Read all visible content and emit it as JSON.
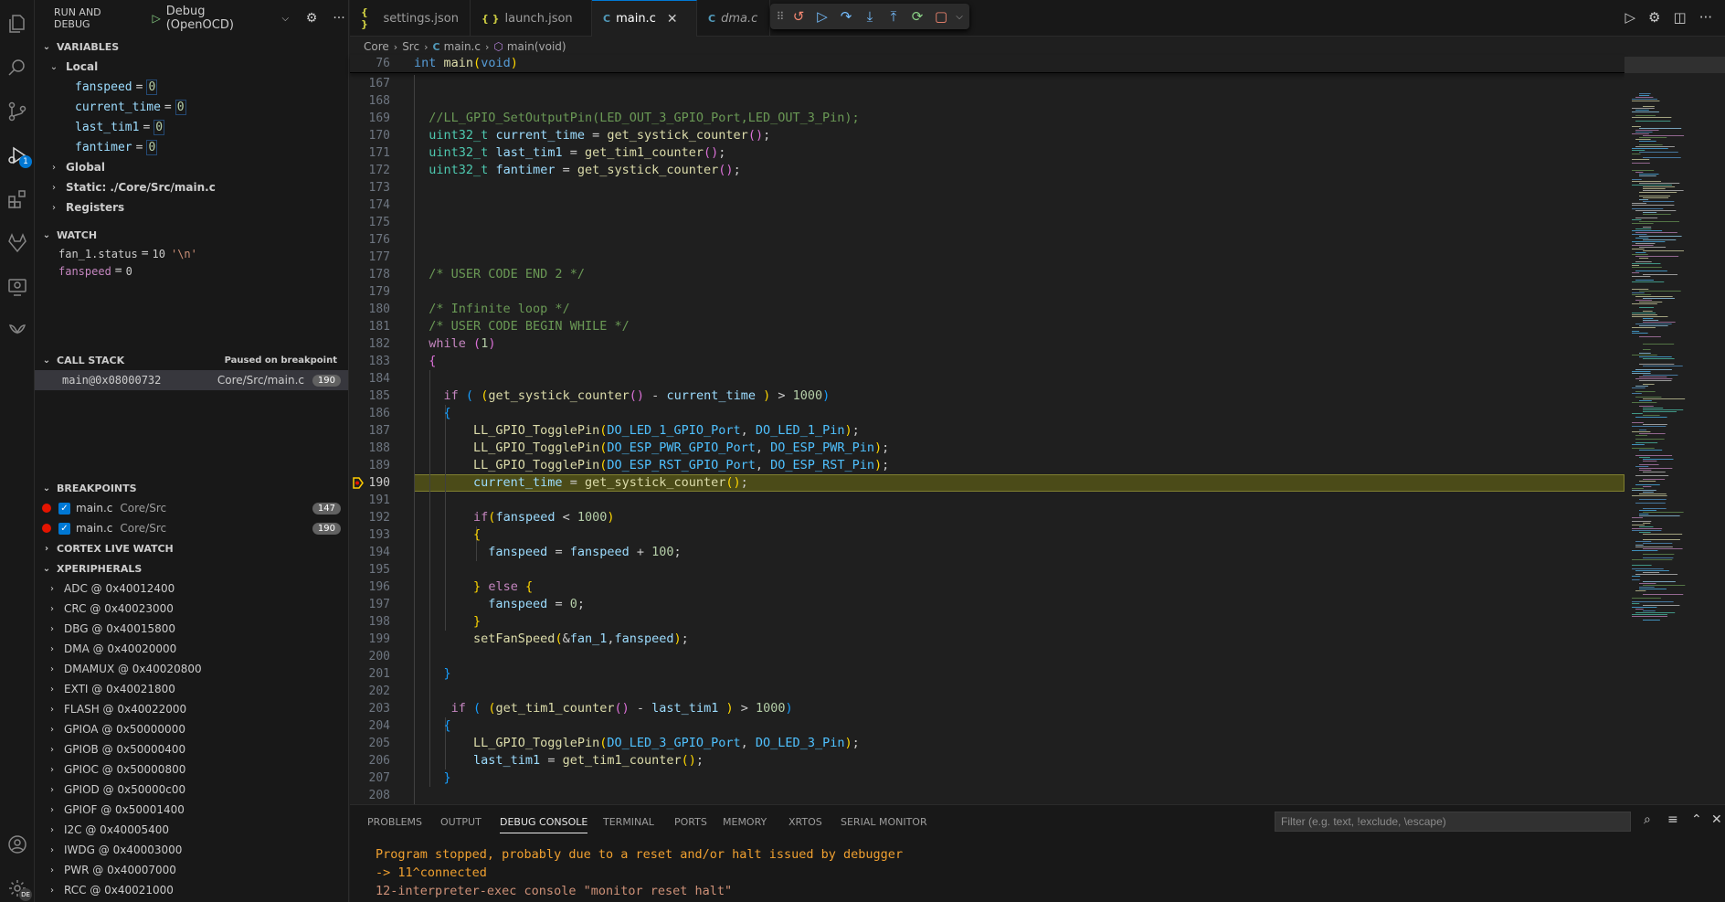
{
  "sidebar": {
    "title": "RUN AND DEBUG",
    "config": "Debug (OpenOCD)",
    "variables": {
      "header": "VARIABLES",
      "local_label": "Local",
      "locals": [
        {
          "name": "fanspeed",
          "value": "0"
        },
        {
          "name": "current_time",
          "value": "0"
        },
        {
          "name": "last_tim1",
          "value": "0"
        },
        {
          "name": "fantimer",
          "value": "0"
        }
      ],
      "global_label": "Global",
      "static_label": "Static: ./Core/Src/main.c",
      "registers_label": "Registers"
    },
    "watch": {
      "header": "WATCH",
      "items": [
        {
          "name": "fan_1.status",
          "value": "10",
          "str": "'\\n'"
        },
        {
          "name": "fanspeed",
          "value": "0",
          "str": ""
        }
      ]
    },
    "call_stack": {
      "header": "CALL STACK",
      "status": "Paused on breakpoint",
      "frames": [
        {
          "frame": "main@0x08000732",
          "file": "Core/Src/main.c",
          "line": "190"
        }
      ]
    },
    "breakpoints": {
      "header": "BREAKPOINTS",
      "items": [
        {
          "file": "main.c",
          "dir": "Core/Src",
          "line": "147"
        },
        {
          "file": "main.c",
          "dir": "Core/Src",
          "line": "190"
        }
      ]
    },
    "cortex_live_watch": "CORTEX LIVE WATCH",
    "xperipherals": {
      "header": "XPERIPHERALS",
      "items": [
        "ADC @ 0x40012400",
        "CRC @ 0x40023000",
        "DBG @ 0x40015800",
        "DMA @ 0x40020000",
        "DMAMUX @ 0x40020800",
        "EXTI @ 0x40021800",
        "FLASH @ 0x40022000",
        "GPIOA @ 0x50000000",
        "GPIOB @ 0x50000400",
        "GPIOC @ 0x50000800",
        "GPIOD @ 0x50000c00",
        "GPIOF @ 0x50001400",
        "I2C @ 0x40005400",
        "IWDG @ 0x40003000",
        "PWR @ 0x40007000",
        "RCC @ 0x40021000"
      ]
    }
  },
  "activity": {
    "debug_badge": "1",
    "account_badge": "DE"
  },
  "tabs": [
    {
      "label": "settings.json",
      "icon": "{ }"
    },
    {
      "label": "launch.json",
      "icon": "{ }"
    },
    {
      "label": "main.c",
      "icon": "C"
    },
    {
      "label": "dma.c",
      "icon": "C"
    }
  ],
  "breadcrumb": {
    "parts": [
      "Core",
      "Src",
      "main.c",
      "main(void)"
    ]
  },
  "sticky": {
    "line": "76",
    "text": "int main(void)"
  },
  "code": {
    "first_line": 167,
    "current_line": 190
  },
  "panel": {
    "tabs": [
      "PROBLEMS",
      "OUTPUT",
      "DEBUG CONSOLE",
      "TERMINAL",
      "PORTS",
      "MEMORY",
      "XRTOS",
      "SERIAL MONITOR"
    ],
    "filter_placeholder": "Filter (e.g. text, !exclude, \\escape)",
    "lines": [
      "Program stopped, probably due to a reset and/or halt issued by debugger",
      "-> 11^connected",
      "12-interpreter-exec console \"monitor reset halt\""
    ]
  }
}
